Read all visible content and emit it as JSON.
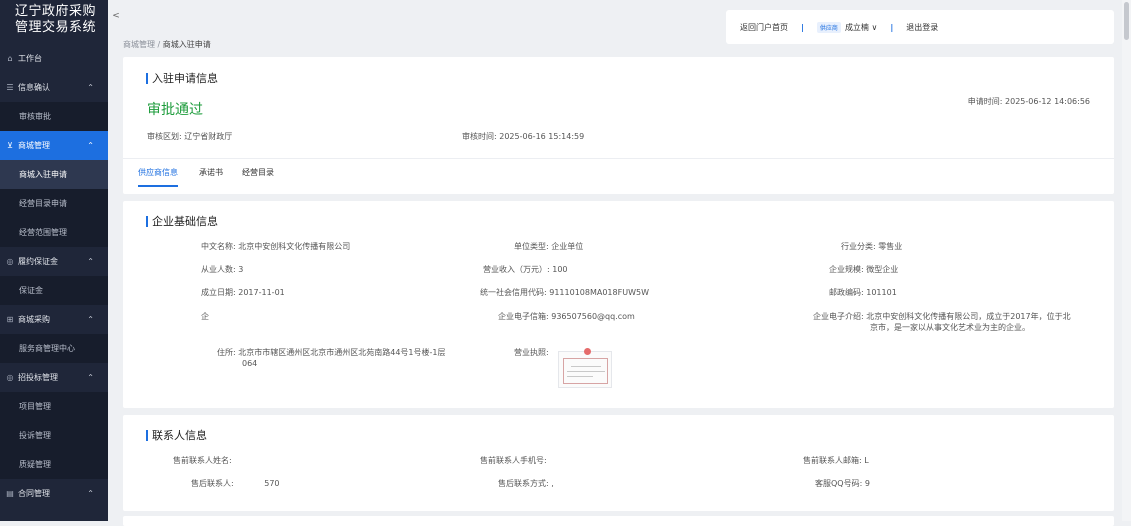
{
  "sidebar": {
    "brand_line1": "辽宁政府采购",
    "brand_line2": "管理交易系统",
    "workbench": "工作台",
    "groups": [
      {
        "label": "信息确认",
        "icon": "document-icon",
        "subs": [
          "审核审批"
        ]
      },
      {
        "label": "商城管理",
        "icon": "cart-icon",
        "active": true,
        "subs": [
          "商城入驻申请",
          "经营目录申请",
          "经营范围管理"
        ]
      },
      {
        "label": "履约保证金",
        "icon": "money-icon",
        "subs": [
          "保证金"
        ]
      },
      {
        "label": "商城采购",
        "icon": "grid-icon",
        "subs": [
          "服务商管理中心"
        ]
      },
      {
        "label": "招投标管理",
        "icon": "gavel-icon",
        "subs": [
          "项目管理",
          "投诉管理",
          "质疑管理"
        ]
      },
      {
        "label": "合同管理",
        "icon": "contract-icon",
        "subs": []
      }
    ],
    "active_sub": "商城入驻申请",
    "collapse_symbol": "<"
  },
  "breadcrumb": {
    "root": "商城管理",
    "sep": "/",
    "current": "商城入驻申请"
  },
  "topbar": {
    "home": "返回门户首页",
    "role": "供应商",
    "user": "成立楠",
    "user_arrow": "∨",
    "logout": "退出登录",
    "sep": "|"
  },
  "application": {
    "title": "入驻申请信息",
    "status": "审批通过",
    "apply_time_label": "申请时间:",
    "apply_time": "2025-06-12 14:06:56",
    "audit_region_label": "审核区划:",
    "audit_region": "辽宁省财政厅",
    "audit_time_label": "审核时间:",
    "audit_time": "2025-06-16 15:14:59",
    "tabs": [
      "供应商信息",
      "承诺书",
      "经营目录"
    ]
  },
  "company": {
    "title": "企业基础信息",
    "name_label": "中文名称:",
    "name": "北京中安创科文化传播有限公司",
    "unit_type_label": "单位类型:",
    "unit_type": "企业单位",
    "industry_label": "行业分类:",
    "industry": "零售业",
    "employees_label": "从业人数:",
    "employees": "3",
    "revenue_label": "营业收入（万元）:",
    "revenue": "100",
    "scale_label": "企业规模:",
    "scale": "微型企业",
    "founded_label": "成立日期:",
    "founded": "2017-11-01",
    "credit_code_label": "统一社会信用代码:",
    "credit_code": "91110108MA018FUW5W",
    "postcode_label": "邮政编码:",
    "postcode": "101101",
    "partial_label": "企",
    "email_label": "企业电子信箱:",
    "email": "936507560@qq.com",
    "intro_label": "企业电子介绍:",
    "intro_line1": "北京中安创科文化传播有限公司，成立于2017年，位于北",
    "intro_line2": "京市，是一家以从事文化艺术业为主的企业。",
    "address_label": "住所:",
    "address_line1": "北京市市辖区通州区北京市通州区北苑南路44号1号楼-1层",
    "address_line2": "064",
    "license_label": "营业执照:"
  },
  "contact": {
    "title": "联系人信息",
    "presale_name_label": "售前联系人姓名:",
    "presale_name": "",
    "presale_phone_label": "售前联系人手机号:",
    "presale_phone": "",
    "presale_email_label": "售前联系人邮箱:",
    "presale_email": "L",
    "aftersale_label": "售后联系人:",
    "aftersale": "570",
    "aftersale_contact_label": "售后联系方式:",
    "aftersale_contact": ",",
    "qq_label": "客服QQ号码:",
    "qq": "9"
  }
}
